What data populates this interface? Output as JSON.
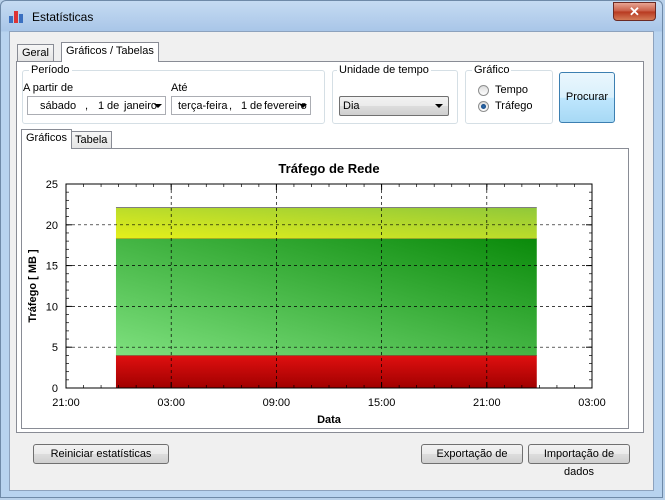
{
  "window": {
    "title": "Estatísticas",
    "close_glyph": "✕",
    "icon": "bar-chart-icon"
  },
  "tabs_main": [
    {
      "label": "Geral"
    },
    {
      "label": "Gráficos / Tabelas"
    }
  ],
  "periodo": {
    "legend": "Período",
    "from_label": "A partir de",
    "from_date": {
      "weekday": "sábado",
      "sep": ",",
      "day": "1",
      "de": "de",
      "month": "janeiro"
    },
    "to_label": "Até",
    "to_date": {
      "weekday": "terça-feira",
      "sep": ",",
      "day": "1",
      "de": "de",
      "month": "fevereiro"
    }
  },
  "unidade": {
    "legend": "Unidade de tempo",
    "selected": "Dia"
  },
  "grafico": {
    "legend": "Gráfico",
    "options": [
      {
        "label": "Tempo",
        "checked": false
      },
      {
        "label": "Tráfego",
        "checked": true
      }
    ]
  },
  "procurar_label": "Procurar",
  "tabs_sub": [
    {
      "label": "Gráficos"
    },
    {
      "label": "Tabela"
    }
  ],
  "chart_data": {
    "type": "area",
    "title": "Tráfego de Rede",
    "xlabel": "Data",
    "ylabel": "Tráfego [ MB ]",
    "ylim": [
      0,
      25
    ],
    "yticks": [
      "0",
      "5",
      "10",
      "15",
      "20",
      "25"
    ],
    "xticks": [
      "21:00",
      "03:00",
      "09:00",
      "15:00",
      "21:00",
      "03:00"
    ],
    "grid": true,
    "bands": [
      {
        "from": 0,
        "to": 4,
        "color_top": "#e01010",
        "color_bottom": "#a00000"
      },
      {
        "from": 4,
        "to": 18.3,
        "color_a": "#7ee07e",
        "color_b": "#0a8a0a"
      },
      {
        "from": 18.3,
        "to": 22.1,
        "color_a": "#e6f01a",
        "color_b": "#90c83a"
      }
    ]
  },
  "buttons": {
    "reset": "Reiniciar estatísticas",
    "export": "Exportação de",
    "import": "Importação de dados"
  }
}
